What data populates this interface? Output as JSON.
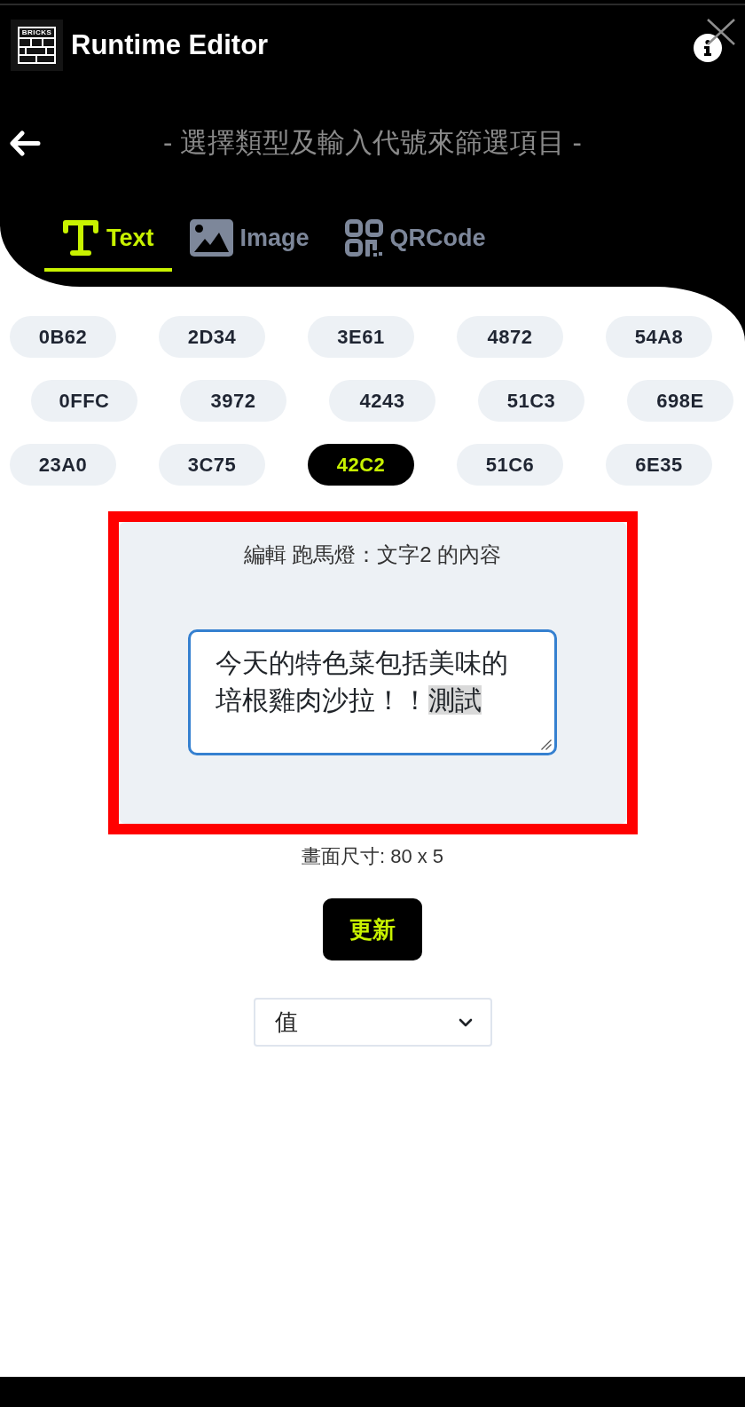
{
  "header": {
    "logo_text": "BRICKS",
    "title": "Runtime Editor"
  },
  "filter_hint": "- 選擇類型及輸入代號來篩選項目 -",
  "tabs": [
    {
      "label": "Text",
      "kind": "text",
      "selected": true
    },
    {
      "label": "Image",
      "kind": "image",
      "selected": false
    },
    {
      "label": "QRCode",
      "kind": "qrcode",
      "selected": false
    }
  ],
  "code_rows": [
    [
      {
        "label": "0B62",
        "selected": false
      },
      {
        "label": "2D34",
        "selected": false
      },
      {
        "label": "3E61",
        "selected": false
      },
      {
        "label": "4872",
        "selected": false
      },
      {
        "label": "54A8",
        "selected": false
      }
    ],
    [
      {
        "label": "0FFC",
        "selected": false
      },
      {
        "label": "3972",
        "selected": false
      },
      {
        "label": "4243",
        "selected": false
      },
      {
        "label": "51C3",
        "selected": false
      },
      {
        "label": "698E",
        "selected": false
      }
    ],
    [
      {
        "label": "23A0",
        "selected": false
      },
      {
        "label": "3C75",
        "selected": false
      },
      {
        "label": "42C2",
        "selected": true
      },
      {
        "label": "51C6",
        "selected": false
      },
      {
        "label": "6E35",
        "selected": false
      }
    ]
  ],
  "editor": {
    "title": "編輯 跑馬燈：文字2 的內容",
    "content": [
      {
        "text": "今天的特色菜包括美味的培根雞肉沙拉！！",
        "selected": false
      },
      {
        "text": "測試",
        "selected": true
      }
    ]
  },
  "screen_size": "畫面尺寸: 80 x 5",
  "update_button": "更新",
  "value_select": {
    "value": "值"
  }
}
